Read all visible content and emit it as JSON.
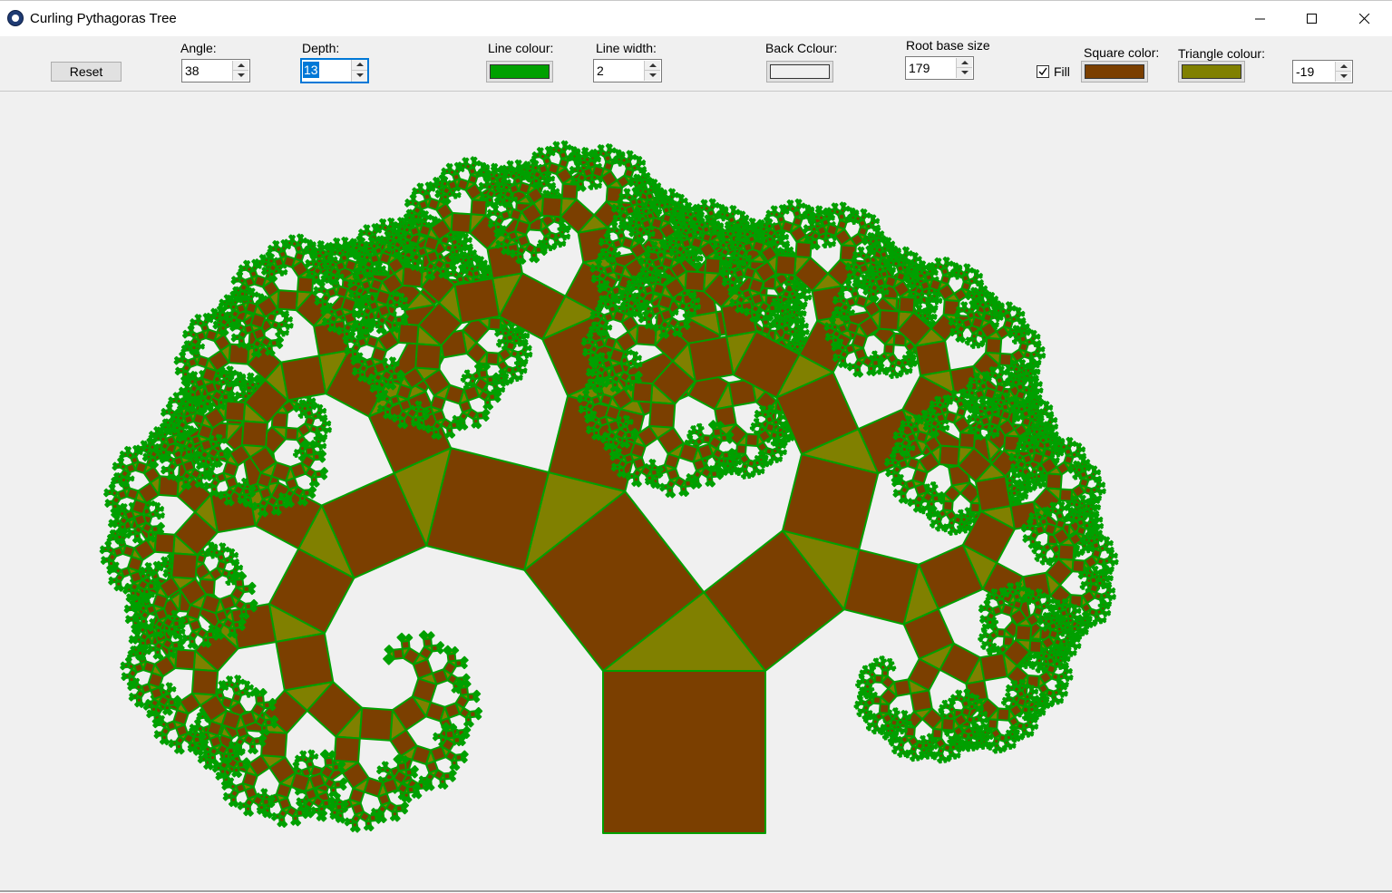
{
  "window": {
    "title": "Curling Pythagoras Tree",
    "icon": "paw-icon",
    "controls": [
      "minimize-icon",
      "maximize-icon",
      "close-icon"
    ]
  },
  "toolbar": {
    "reset_label": "Reset",
    "angle": {
      "label": "Angle:",
      "value": "38"
    },
    "depth": {
      "label": "Depth:",
      "value": "13"
    },
    "line_colour": {
      "label": "Line colour:",
      "color": "#00a000"
    },
    "line_width": {
      "label": "Line width:",
      "value": "2"
    },
    "back_colour": {
      "label": "Back Cclour:",
      "color": "#f0f0f0"
    },
    "root_base_size": {
      "label": "Root base size",
      "value": "179"
    },
    "fill": {
      "label": "Fill",
      "checked": true
    },
    "square_color": {
      "label": "Square color:",
      "color": "#7b3f00"
    },
    "triangle_colour": {
      "label": "Triangle colour:",
      "color": "#808000"
    },
    "offset": {
      "value": "-19"
    }
  }
}
